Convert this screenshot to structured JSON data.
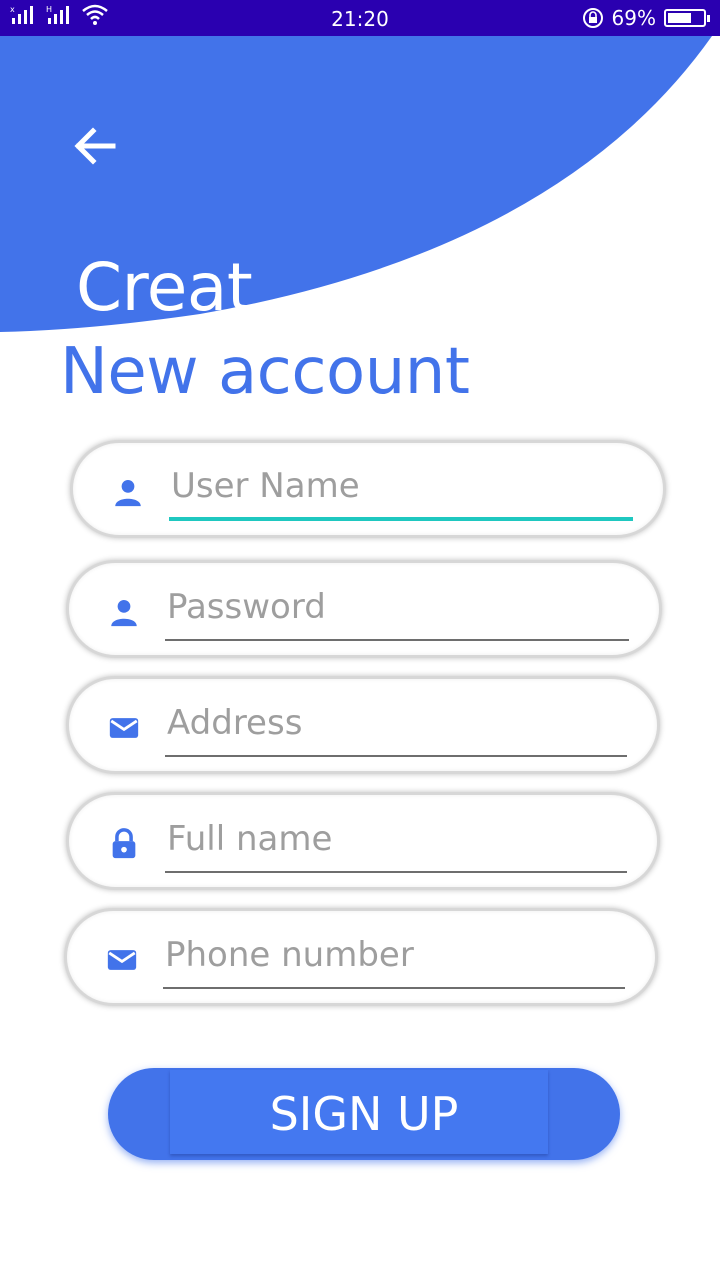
{
  "status_bar": {
    "time": "21:20",
    "battery_text": "69%",
    "battery_level": 0.69,
    "signal_icons": [
      "signal-icon",
      "signal-icon",
      "wifi-icon"
    ],
    "rotation_lock_icon": "rotation-lock-icon"
  },
  "colors": {
    "primary": "#4273ea",
    "status_bar": "#2a00b0",
    "focus_underline": "#1fc8c0",
    "placeholder": "#9e9e9e"
  },
  "header": {
    "back_icon": "arrow-left-icon",
    "title_line1": "Creat",
    "title_line2": "New account"
  },
  "form": {
    "fields": [
      {
        "name": "username",
        "icon": "person-icon",
        "placeholder": "User Name",
        "value": "",
        "focused": true
      },
      {
        "name": "password",
        "icon": "person-icon",
        "placeholder": "Password",
        "value": "",
        "focused": false
      },
      {
        "name": "address",
        "icon": "mail-icon",
        "placeholder": "Address",
        "value": "",
        "focused": false
      },
      {
        "name": "fullname",
        "icon": "lock-icon",
        "placeholder": "Full name",
        "value": "",
        "focused": false
      },
      {
        "name": "phone",
        "icon": "mail-icon",
        "placeholder": "Phone number",
        "value": "",
        "focused": false
      }
    ],
    "submit_label": "SIGN UP"
  }
}
